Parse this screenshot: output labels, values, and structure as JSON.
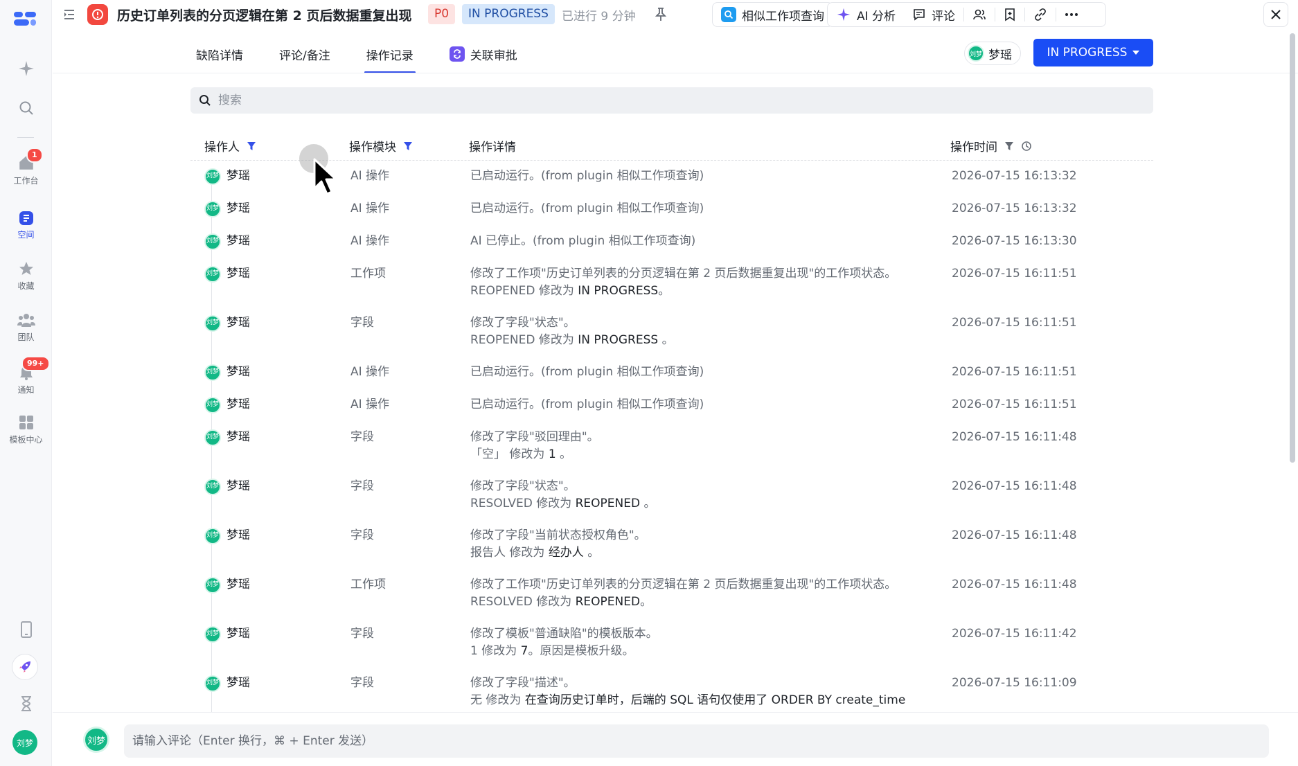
{
  "rail": {
    "items": [
      {
        "label": "",
        "icon": "sparkle-icon"
      },
      {
        "label": "",
        "icon": "search-icon"
      },
      {
        "label": "工作台",
        "icon": "home-icon",
        "badge": "1"
      },
      {
        "label": "空间",
        "icon": "space-icon"
      },
      {
        "label": "收藏",
        "icon": "star-icon"
      },
      {
        "label": "团队",
        "icon": "team-icon"
      },
      {
        "label": "通知",
        "icon": "bell-icon",
        "badge": "99+"
      },
      {
        "label": "模板中心",
        "icon": "template-icon"
      }
    ],
    "avatar": "刘梦"
  },
  "header": {
    "title": "历史订单列表的分页逻辑在第 2 页后数据重复出现",
    "priority": "P0",
    "status": "IN PROGRESS",
    "elapsed": "已进行 9 分钟",
    "similar_label": "相似工作项查询",
    "ai_label": "AI 分析",
    "comment_label": "评论"
  },
  "tabs": [
    {
      "label": "缺陷详情"
    },
    {
      "label": "评论/备注"
    },
    {
      "label": "操作记录"
    },
    {
      "label": "关联审批"
    }
  ],
  "assignee": {
    "name": "梦瑶",
    "avatar": "刘梦"
  },
  "status_button": "IN PROGRESS",
  "search": {
    "placeholder": "搜索"
  },
  "table": {
    "columns": {
      "operator": "操作人",
      "module": "操作模块",
      "detail": "操作详情",
      "time": "操作时间"
    },
    "rows": [
      {
        "operator": "梦瑶",
        "module": "AI 操作",
        "line1": "已启动运行。(from plugin 相似工作项查询)",
        "line2": "",
        "l2_from": "",
        "l2_mid": "",
        "l2_to": "",
        "time": "2026-07-15 16:13:32"
      },
      {
        "operator": "梦瑶",
        "module": "AI 操作",
        "line1": "已启动运行。(from plugin 相似工作项查询)",
        "line2": "",
        "l2_from": "",
        "l2_mid": "",
        "l2_to": "",
        "time": "2026-07-15 16:13:32"
      },
      {
        "operator": "梦瑶",
        "module": "AI 操作",
        "line1": "AI 已停止。(from plugin 相似工作项查询)",
        "line2": "",
        "l2_from": "",
        "l2_mid": "",
        "l2_to": "",
        "time": "2026-07-15 16:13:30"
      },
      {
        "operator": "梦瑶",
        "module": "工作项",
        "line1": "修改了工作项\"历史订单列表的分页逻辑在第 2 页后数据重复出现\"的工作项状态。",
        "l2_from": "REOPENED",
        "l2_mid": "修改为",
        "l2_to": "IN PROGRESS",
        "l2_tail": "。",
        "time": "2026-07-15 16:11:51"
      },
      {
        "operator": "梦瑶",
        "module": "字段",
        "line1": "修改了字段\"状态\"。",
        "l2_from": "REOPENED",
        "l2_mid": "修改为",
        "l2_to": "IN PROGRESS",
        "l2_tail": " 。",
        "time": "2026-07-15 16:11:51"
      },
      {
        "operator": "梦瑶",
        "module": "AI 操作",
        "line1": "已启动运行。(from plugin 相似工作项查询)",
        "l2_from": "",
        "l2_mid": "",
        "l2_to": "",
        "time": "2026-07-15 16:11:51"
      },
      {
        "operator": "梦瑶",
        "module": "AI 操作",
        "line1": "已启动运行。(from plugin 相似工作项查询)",
        "l2_from": "",
        "l2_mid": "",
        "l2_to": "",
        "time": "2026-07-15 16:11:51"
      },
      {
        "operator": "梦瑶",
        "module": "字段",
        "line1": "修改了字段\"驳回理由\"。",
        "l2_from": "「空」",
        "l2_mid": "修改为",
        "l2_to": "1",
        "l2_tail": " 。",
        "time": "2026-07-15 16:11:48"
      },
      {
        "operator": "梦瑶",
        "module": "字段",
        "line1": "修改了字段\"状态\"。",
        "l2_from": "RESOLVED",
        "l2_mid": "修改为",
        "l2_to": "REOPENED",
        "l2_tail": " 。",
        "time": "2026-07-15 16:11:48"
      },
      {
        "operator": "梦瑶",
        "module": "字段",
        "line1": "修改了字段\"当前状态授权角色\"。",
        "l2_from": "报告人",
        "l2_mid": "修改为",
        "l2_to": "经办人",
        "l2_tail": " 。",
        "time": "2026-07-15 16:11:48"
      },
      {
        "operator": "梦瑶",
        "module": "工作项",
        "line1": "修改了工作项\"历史订单列表的分页逻辑在第 2 页后数据重复出现\"的工作项状态。",
        "l2_from": "RESOLVED",
        "l2_mid": "修改为",
        "l2_to": "REOPENED",
        "l2_tail": "。",
        "time": "2026-07-15 16:11:48"
      },
      {
        "operator": "梦瑶",
        "module": "字段",
        "line1": "修改了模板\"普通缺陷\"的模板版本。",
        "l2_from": "1",
        "l2_mid": "修改为",
        "l2_to": "7",
        "l2_tail": "。原因是模板升级。",
        "time": "2026-07-15 16:11:42"
      },
      {
        "operator": "梦瑶",
        "module": "字段",
        "line1": "修改了字段\"描述\"。",
        "l2_from": "无",
        "l2_mid": "修改为",
        "l2_to": "在查询历史订单时，后端的 SQL 语句仅使用了 ORDER BY create_time",
        "l2_tail": "",
        "time": "2026-07-15 16:11:09"
      }
    ]
  },
  "comment": {
    "avatar": "刘梦",
    "placeholder": "请输入评论（Enter 换行，⌘ + Enter 发送）"
  },
  "colors": {
    "accent": "#1a4df5",
    "danger": "#f2483f",
    "avatar": "#12b886"
  }
}
